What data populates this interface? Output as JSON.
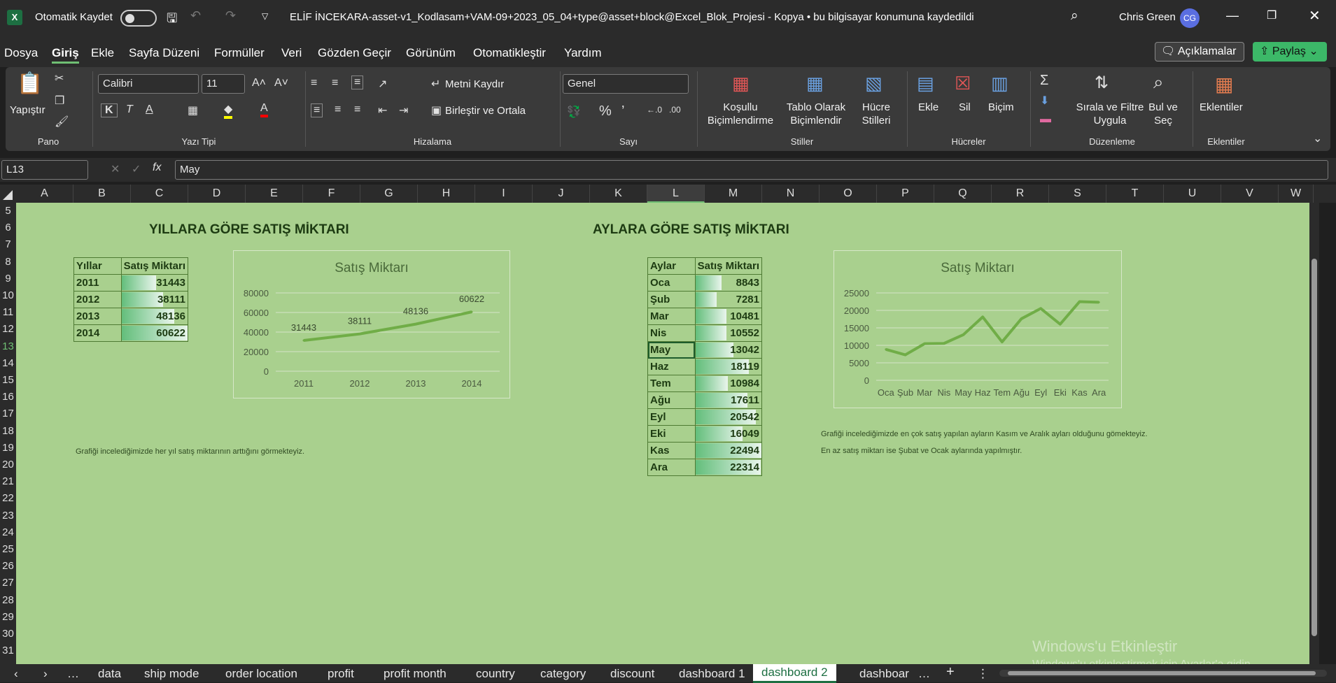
{
  "titlebar": {
    "autosave_label": "Otomatik Kaydet",
    "doc_title": "ELİF İNCEKARA-asset-v1_Kodlasam+VAM-09+2023_05_04+type@asset+block@Excel_Blok_Projesi - Kopya • bu bilgisayar konumuna kaydedildi",
    "user_name": "Chris Green",
    "user_initials": "CG"
  },
  "menu": {
    "items": [
      "Dosya",
      "Giriş",
      "Ekle",
      "Sayfa Düzeni",
      "Formüller",
      "Veri",
      "Gözden Geçir",
      "Görünüm",
      "Otomatikleştir",
      "Yardım"
    ],
    "comments_label": "Açıklamalar",
    "share_label": "Paylaş"
  },
  "ribbon": {
    "paste_label": "Yapıştır",
    "clipboard_group": "Pano",
    "font_name": "Calibri",
    "font_size": "11",
    "font_group": "Yazı Tipi",
    "wrap_text": "Metni Kaydır",
    "merge_center": "Birleştir ve Ortala",
    "alignment_group": "Hizalama",
    "number_format": "Genel",
    "number_group": "Sayı",
    "cond_format": "Koşullu Biçimlendirme",
    "format_table": "Tablo Olarak Biçimlendir",
    "cell_styles": "Hücre Stilleri",
    "styles_group": "Stiller",
    "insert": "Ekle",
    "delete": "Sil",
    "format": "Biçim",
    "cells_group": "Hücreler",
    "sort_filter": "Sırala ve Filtre Uygula",
    "find_select": "Bul ve Seç",
    "editing_group": "Düzenleme",
    "addins": "Eklentiler",
    "addins_group": "Eklentiler"
  },
  "formula_bar": {
    "name_box": "L13",
    "value": "May"
  },
  "columns": [
    "A",
    "B",
    "C",
    "D",
    "E",
    "F",
    "G",
    "H",
    "I",
    "J",
    "K",
    "L",
    "M",
    "N",
    "O",
    "P",
    "Q",
    "R",
    "S",
    "T",
    "U",
    "V",
    "W"
  ],
  "rows": [
    "5",
    "6",
    "7",
    "8",
    "9",
    "10",
    "11",
    "12",
    "13",
    "14",
    "15",
    "16",
    "17",
    "18",
    "19",
    "20",
    "21",
    "22",
    "23",
    "24",
    "25",
    "26",
    "27",
    "28",
    "29",
    "30",
    "31"
  ],
  "sheet": {
    "title_left": "YILLARA GÖRE SATIŞ MİKTARI",
    "title_right": "AYLARA GÖRE SATIŞ MİKTARI",
    "yearly_table": {
      "headers": [
        "Yıllar",
        "Satış Miktarı"
      ],
      "rows": [
        [
          "2011",
          "31443"
        ],
        [
          "2012",
          "38111"
        ],
        [
          "2013",
          "48136"
        ],
        [
          "2014",
          "60622"
        ]
      ]
    },
    "monthly_table": {
      "headers": [
        "Aylar",
        "Satış Miktarı"
      ],
      "rows": [
        [
          "Oca",
          "8843"
        ],
        [
          "Şub",
          "7281"
        ],
        [
          "Mar",
          "10481"
        ],
        [
          "Nis",
          "10552"
        ],
        [
          "May",
          "13042"
        ],
        [
          "Haz",
          "18119"
        ],
        [
          "Tem",
          "10984"
        ],
        [
          "Ağu",
          "17611"
        ],
        [
          "Eyl",
          "20542"
        ],
        [
          "Eki",
          "16049"
        ],
        [
          "Kas",
          "22494"
        ],
        [
          "Ara",
          "22314"
        ]
      ]
    },
    "note_left": "Grafiği incelediğimizde her yıl satış miktarının arttığını görmekteyiz.",
    "note_right_1": "Grafiği incelediğimizde en çok satış yapılan ayların Kasım ve Aralık ayları olduğunu gömekteyiz.",
    "note_right_2": "En az satış miktarı ise Şubat ve Ocak aylarında yapılmıştır.",
    "watermark_1": "Windows'u Etkinleştir",
    "watermark_2": "Windows'u etkinleştirmek için Ayarlar'a gidin."
  },
  "chart_data": [
    {
      "type": "line",
      "title": "Satış Miktarı",
      "categories": [
        "2011",
        "2012",
        "2013",
        "2014"
      ],
      "series": [
        {
          "values": [
            31443,
            38111,
            48136,
            60622
          ]
        }
      ],
      "ylim": [
        0,
        80000
      ],
      "yticks": [
        "0",
        "20000",
        "40000",
        "60000",
        "80000"
      ],
      "data_labels": true,
      "grid": true,
      "color": "#70ad47"
    },
    {
      "type": "line",
      "title": "Satış Miktarı",
      "categories": [
        "Oca",
        "Şub",
        "Mar",
        "Nis",
        "May",
        "Haz",
        "Tem",
        "Ağu",
        "Eyl",
        "Eki",
        "Kas",
        "Ara"
      ],
      "series": [
        {
          "values": [
            8843,
            7281,
            10481,
            10552,
            13042,
            18119,
            10984,
            17611,
            20542,
            16049,
            22494,
            22314
          ]
        }
      ],
      "ylim": [
        0,
        25000
      ],
      "yticks": [
        "0",
        "5000",
        "10000",
        "15000",
        "20000",
        "25000"
      ],
      "data_labels": false,
      "grid": true,
      "color": "#70ad47"
    }
  ],
  "tabs": {
    "items": [
      "data",
      "ship mode",
      "order location",
      "profit",
      "profit month",
      "country",
      "category",
      "discount",
      "dashboard 1",
      "dashboard 2",
      "dashboar"
    ],
    "active": "dashboard 2"
  }
}
